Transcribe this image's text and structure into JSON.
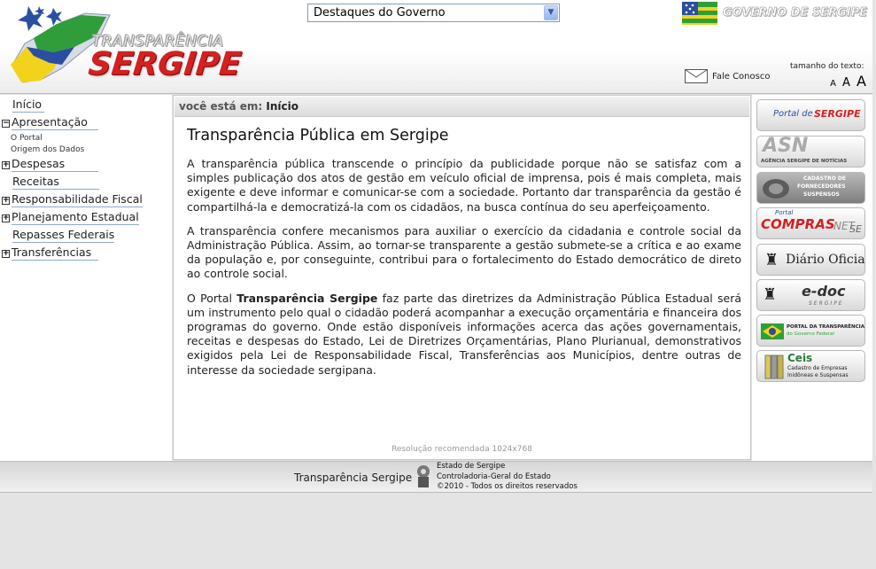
{
  "header": {
    "logo_small": "TRANSPARÊNCIA",
    "logo_big": "SERGIPE",
    "destaques_selected": "Destaques do Governo",
    "gov_label": "GOVERNO DE SERGIPE",
    "fale_conosco": "Fale Conosco",
    "font_size_label": "tamanho do texto:",
    "font_sizes": [
      "A",
      "A",
      "A"
    ]
  },
  "nav": {
    "inicio": "Início",
    "apresentacao": "Apresentação",
    "apresentacao_sub": [
      "O Portal",
      "Origem dos Dados"
    ],
    "despesas": "Despesas",
    "receitas": "Receitas",
    "responsabilidade": "Responsabilidade Fiscal",
    "planejamento": "Planejamento Estadual",
    "repasses": "Repasses Federais",
    "transferencias": "Transferências",
    "toggle_minus": "−",
    "toggle_plus": "+"
  },
  "main": {
    "breadcrumb_label": "você está em:",
    "breadcrumb_current": "Início",
    "title": "Transparência Pública em Sergipe",
    "p1": "A transparência pública transcende o princípio da publicidade porque não se satisfaz com a simples publicação dos atos de gestão em veículo oficial de imprensa, pois é mais completa, mais exigente e deve informar e comunicar-se com a sociedade. Portanto dar transparência da gestão é compartilhá-la e democratizá-la com os cidadãos, na busca contínua do seu aperfeiçoamento.",
    "p2": "A transparência confere mecanismos para auxiliar o exercício da cidadania e controle social da Administração Pública. Assim, ao tornar-se transparente a gestão submete-se a crítica e ao exame da população e, por conseguinte, contribui para o fortalecimento do Estado democrático de direto ao controle social.",
    "p3_start": "O Portal ",
    "p3_bold": "Transparência Sergipe",
    "p3_end": " faz parte das diretrizes da Administração Pública Estadual será um instrumento pelo qual o cidadão poderá acompanhar a execução orçamentária e financeira dos programas do governo. Onde estão disponíveis informações acerca das ações governamentais, receitas e despesas do Estado, Lei de Diretrizes Orçamentárias, Plano Plurianual, demonstrativos exigidos pela Lei de Responsabilidade Fiscal, Transferências aos Municípios, dentre outras de interesse da sociedade sergipana.",
    "resolution": "Resolução recomendada 1024x768"
  },
  "banners": {
    "portal_a": "Portal de",
    "portal_b": "SERGIPE",
    "asn_a": "ASN",
    "asn_b": "AGÊNCIA SERGIPE DE NOTÍCIAS",
    "cadastro_a": "CADASTRO DE",
    "cadastro_b": "FORNECEDORES",
    "cadastro_c": "SUSPENSOS",
    "compras_a": "Portal",
    "compras_b": "COMPRAS",
    "compras_c": "NET",
    "compras_d": "SE",
    "diario": "Diário Oficial",
    "edoc_a": "e-doc",
    "edoc_b": "SERGIPE",
    "federal_a": "PORTAL DA TRANSPARÊNCIA",
    "federal_b": "do Governo Federal",
    "ceis_a": "Ceis",
    "ceis_b": "Cadastro de Empresas",
    "ceis_c": "Inidôneas e Suspensas"
  },
  "footer": {
    "site": "Transparência Sergipe",
    "line1": "Estado de Sergipe",
    "line2": "Controladoria-Geral do Estado",
    "line3": "©2010 - Todos os direitos reservados"
  },
  "colors": {
    "brand_red": "#d32020",
    "brand_yellow": "#f3d21c",
    "brand_green": "#2f9e3a",
    "brand_blue": "#2b4fa0",
    "nav_underline": "#8eaacb"
  }
}
